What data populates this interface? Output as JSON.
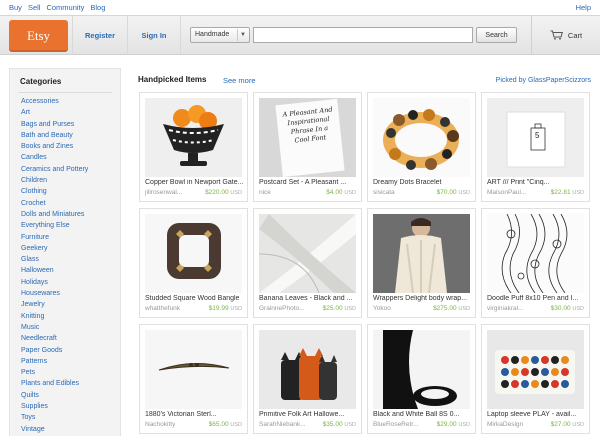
{
  "topnav": {
    "links": [
      "Buy",
      "Sell",
      "Community",
      "Blog"
    ],
    "help": "Help"
  },
  "header": {
    "logo": "Etsy",
    "register": "Register",
    "signin": "Sign In",
    "search_category": "Handmade",
    "search_value": "",
    "search_button": "Search",
    "cart": "Cart"
  },
  "sidebar": {
    "title": "Categories",
    "items": [
      "Accessories",
      "Art",
      "Bags and Purses",
      "Bath and Beauty",
      "Books and Zines",
      "Candles",
      "Ceramics and Pottery",
      "Children",
      "Clothing",
      "Crochet",
      "Dolls and Miniatures",
      "Everything Else",
      "Furniture",
      "Geekery",
      "Glass",
      "Halloween",
      "Holidays",
      "Housewares",
      "Jewelry",
      "Knitting",
      "Music",
      "Needlecraft",
      "Paper Goods",
      "Patterns",
      "Pets",
      "Plants and Edibles",
      "Quilts",
      "Supplies",
      "Toys",
      "Vintage"
    ]
  },
  "main": {
    "heading": "Handpicked Items",
    "see_more": "See more",
    "picked_by": "Picked by GlassPaperScizzors"
  },
  "currency": "USD",
  "items": [
    {
      "title": "Copper Bowl in Newport Gate...",
      "seller": "jillrosenwal...",
      "price": "$220.00",
      "icon": "patterned-bowl-image"
    },
    {
      "title": "Postcard Set - A Pleasant ...",
      "seller": "nice",
      "price": "$4.00",
      "icon": "postcard-image",
      "postcard_text": "A Pleasant And Inspirational Phrase In a Cool Font"
    },
    {
      "title": "Dreamy Dots Bracelet",
      "seller": "sisicata",
      "price": "$70.00",
      "icon": "bracelet-image"
    },
    {
      "title": "ART /// Print \"Cinq...",
      "seller": "MaisonPaul...",
      "price": "$22.81",
      "icon": "art-print-image",
      "print_text": "5"
    },
    {
      "title": "Studded Square Wood Bangle",
      "seller": "whatthefunk",
      "price": "$19.99",
      "icon": "square-bangle-image"
    },
    {
      "title": "Banana Leaves - Black and ...",
      "seller": "GrainnePhoto...",
      "price": "$25.00",
      "icon": "banana-leaves-image"
    },
    {
      "title": "Wrappers Delight body wrap...",
      "seller": "Yokoo",
      "price": "$275.00",
      "icon": "knit-wrap-image"
    },
    {
      "title": "Doodle Puff 8x10 Pen and I...",
      "seller": "virginiakral...",
      "price": "$30.00",
      "icon": "doodle-art-image"
    },
    {
      "title": "1880's Victorian Sterl...",
      "seller": "Nachokitty",
      "price": "$65.00",
      "icon": "victorian-pin-image"
    },
    {
      "title": "Primitive Folk Art Hallowe...",
      "seller": "SarahNiebank...",
      "price": "$35.00",
      "icon": "folk-cats-image"
    },
    {
      "title": "Black and White Ball 8S 0...",
      "seller": "BlueRoseRetr...",
      "price": "$29.00",
      "icon": "black-white-photo-image"
    },
    {
      "title": "Laptop sleeve PLAY - avail...",
      "seller": "MirkaDesign",
      "price": "$27.00",
      "icon": "laptop-sleeve-image"
    }
  ]
}
